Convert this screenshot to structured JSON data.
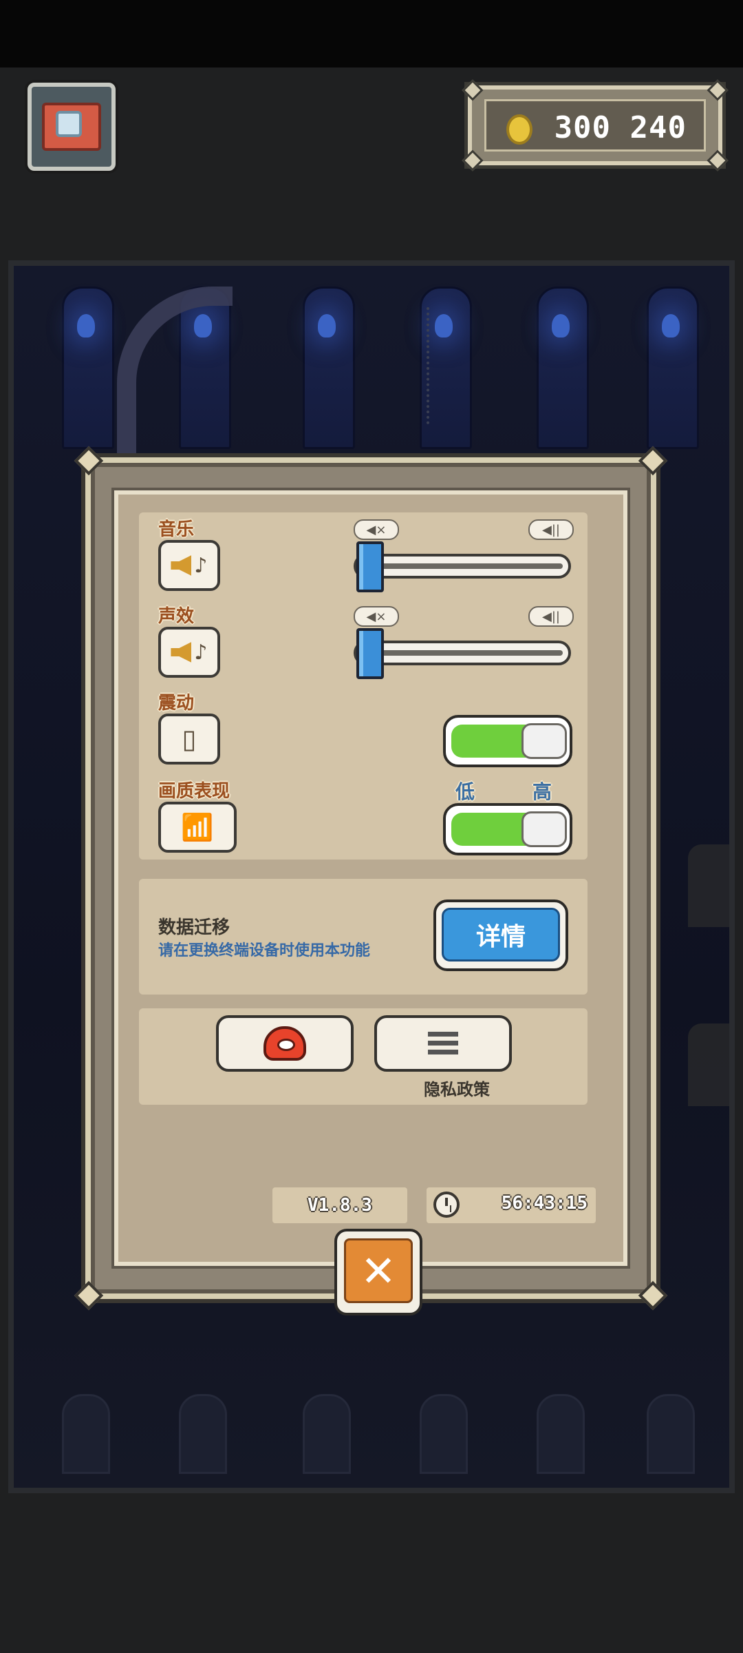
{
  "header": {
    "camera_icon": "camera-icon",
    "coin_icon": "gold-coin-icon",
    "coins": "300 240"
  },
  "settings": {
    "music": {
      "label": "音乐",
      "icon": "speaker-music-icon",
      "min_icon": "mute-icon",
      "max_icon": "volume-max-icon",
      "value_fraction": 0.0
    },
    "sfx": {
      "label": "声效",
      "icon": "speaker-sfx-icon",
      "min_icon": "mute-icon",
      "max_icon": "volume-max-icon",
      "value_fraction": 0.0
    },
    "vibration": {
      "label": "震动",
      "icon": "phone-vibrate-icon",
      "enabled": true
    },
    "graphics": {
      "label": "画质表现",
      "icon": "graphics-chart-icon",
      "low_label": "低",
      "high_label": "高",
      "enabled": true
    }
  },
  "migration": {
    "title": "数据迁移",
    "subtitle": "请在更换终端设备时使用本功能",
    "button_label": "详情"
  },
  "links": {
    "support_icon": "customer-service-phone-icon",
    "privacy_icon": "list-icon",
    "privacy_label": "隐私政策"
  },
  "footer": {
    "version": "V1.8.3",
    "timer": "56:43:15",
    "close_label": "✕"
  },
  "colors": {
    "accent_green": "#6fcf3d",
    "accent_blue": "#3a97dc",
    "close_orange": "#e38a35",
    "label_brown": "#9b4f1f"
  }
}
